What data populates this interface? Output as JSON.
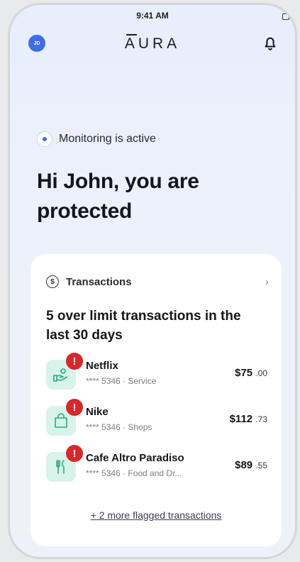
{
  "status_bar": {
    "time": "9:41 AM"
  },
  "header": {
    "avatar_initials": "JD",
    "logo_text": "URA",
    "logo_first_letter": "A"
  },
  "monitoring": {
    "text": "Monitoring is active"
  },
  "greeting": {
    "text": "Hi John, you are protected"
  },
  "transactions_card": {
    "title": "Transactions",
    "headline": "5 over limit transactions in the last 30 days",
    "alert_symbol": "!",
    "items": [
      {
        "name": "Netflix",
        "meta": "**** 5346 · Service",
        "amount_main": "$75",
        "amount_cents": ".00",
        "icon": "hand-coins-icon"
      },
      {
        "name": "Nike",
        "meta": "**** 5346 · Shops",
        "amount_main": "$112",
        "amount_cents": ".73",
        "icon": "shopping-bag-icon"
      },
      {
        "name": "Cafe Altro Paradiso",
        "meta": "**** 5346 · Food and Dr...",
        "amount_main": "$89",
        "amount_cents": ".55",
        "icon": "fork-knife-icon"
      }
    ],
    "more_link": "+ 2 more flagged transactions"
  },
  "colors": {
    "accent": "#3c6de8",
    "alert": "#d9262b",
    "icon_bg": "#d8f3ea",
    "icon_fg": "#2aa980"
  }
}
